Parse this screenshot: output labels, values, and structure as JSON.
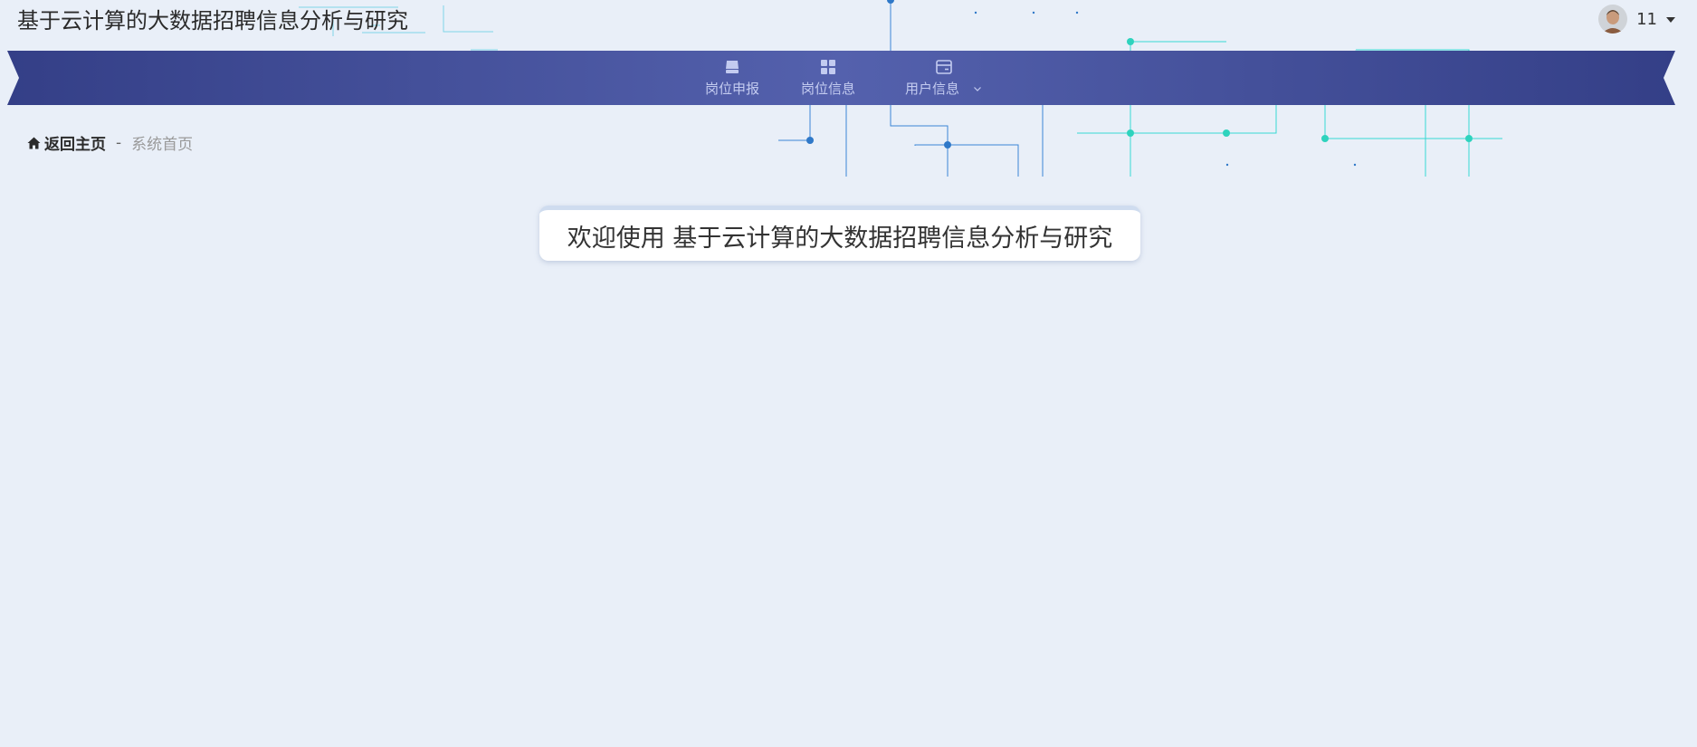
{
  "header": {
    "title": "基于云计算的大数据招聘信息分析与研究",
    "user": {
      "name": "11",
      "avatar_icon": "user-avatar-icon"
    }
  },
  "nav": {
    "items": [
      {
        "label": "岗位申报",
        "icon": "archive-box-icon"
      },
      {
        "label": "岗位信息",
        "icon": "grid-apps-icon"
      },
      {
        "label": "用户信息",
        "icon": "card-window-icon",
        "has_dropdown": true
      }
    ]
  },
  "breadcrumb": {
    "home_label": "返回主页",
    "separator": "-",
    "current": "系统首页"
  },
  "welcome": {
    "text": "欢迎使用 基于云计算的大数据招聘信息分析与研究"
  },
  "colors": {
    "background": "#e9eff8",
    "ribbon_dark": "#343f87",
    "ribbon_light": "#5461ad",
    "nav_text": "#c3cbf0",
    "circuit_blue": "#2f78c8",
    "circuit_cyan": "#2ed3cf"
  }
}
